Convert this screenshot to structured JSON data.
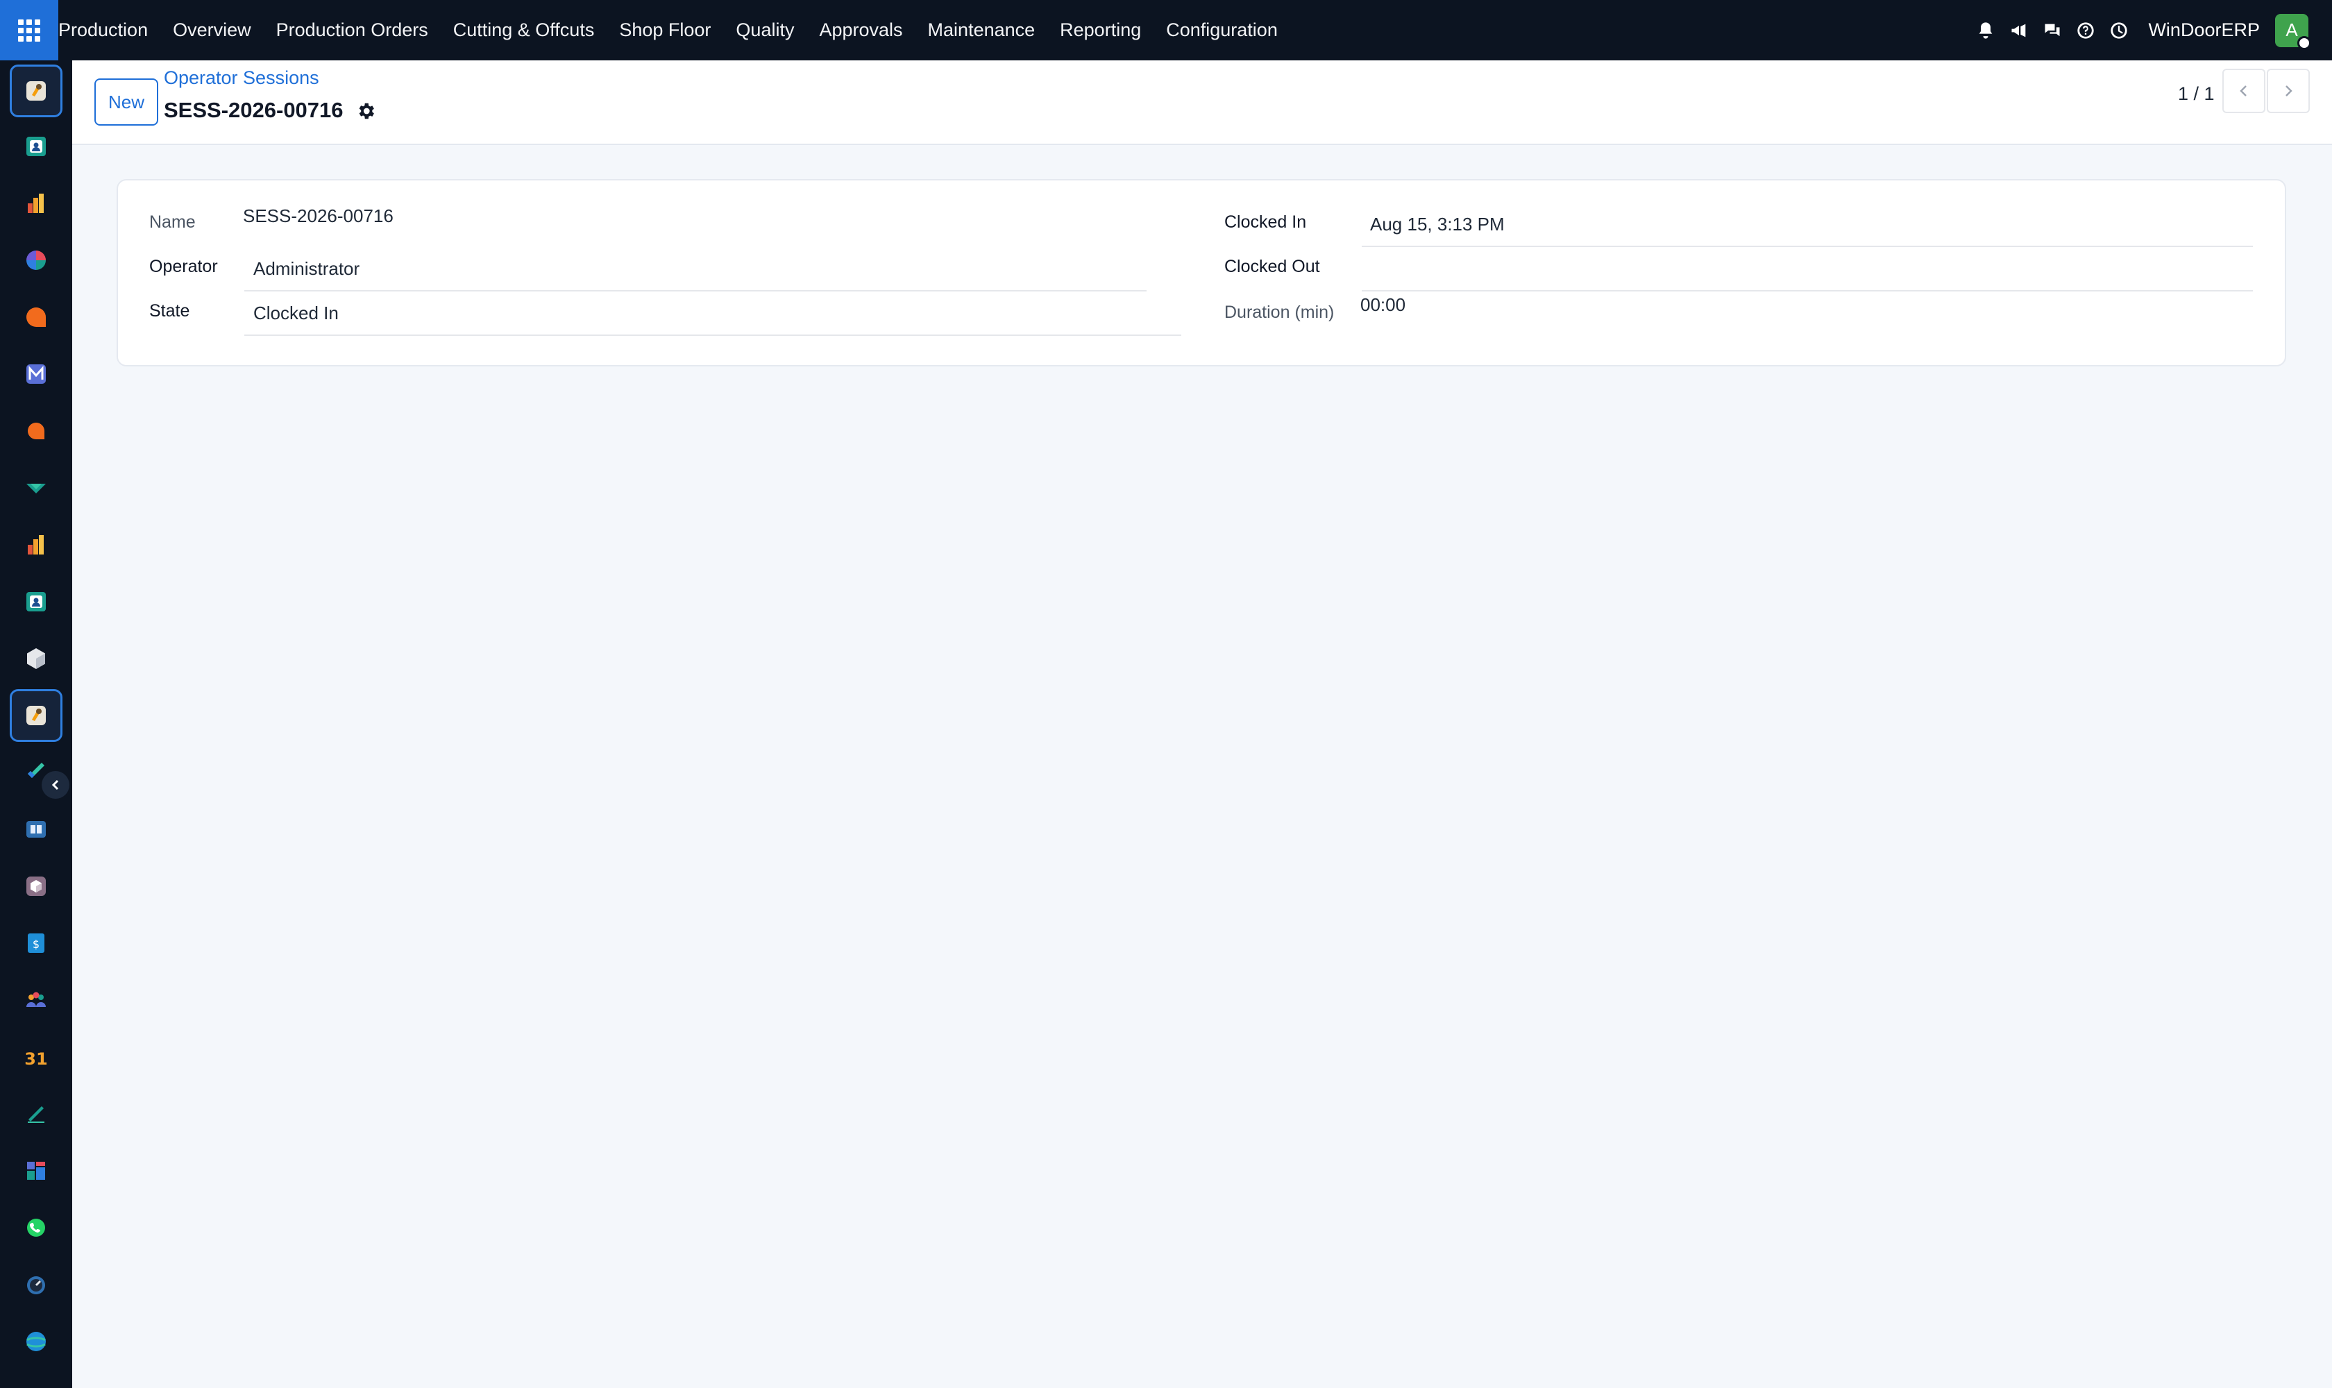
{
  "navbar": {
    "menu": [
      "Production",
      "Overview",
      "Production Orders",
      "Cutting & Offcuts",
      "Shop Floor",
      "Quality",
      "Approvals",
      "Maintenance",
      "Reporting",
      "Configuration"
    ],
    "company": "WinDoorERP",
    "avatar_initial": "A",
    "tray_icons": [
      "bell-icon",
      "megaphone-icon",
      "chat-icon",
      "help-icon",
      "clock-icon"
    ]
  },
  "sidebar": {
    "apps": [
      "production-app",
      "contacts-app",
      "reporting-app",
      "dashboard-app",
      "discuss-app",
      "email-app",
      "livechat-app",
      "project-app",
      "analytics-app",
      "employees-app",
      "inventory-app",
      "production-app-active",
      "todo-app",
      "knowledge-app",
      "product-app",
      "invoicing-app",
      "team-app",
      "calendar-app",
      "sign-app",
      "spreadsheet-app",
      "whatsapp-app",
      "timer-app",
      "website-app"
    ]
  },
  "control_panel": {
    "new_label": "New",
    "breadcrumb": "Operator Sessions",
    "record_title": "SESS-2026-00716",
    "pager": "1 / 1"
  },
  "form": {
    "name_label": "Name",
    "name_value": "SESS-2026-00716",
    "operator_label": "Operator",
    "operator_value": "Administrator",
    "state_label": "State",
    "state_value": "Clocked In",
    "clocked_in_label": "Clocked In",
    "clocked_in_value": "Aug 15, 3:13 PM",
    "clocked_out_label": "Clocked Out",
    "clocked_out_value": "",
    "duration_label": "Duration (min)",
    "duration_value": "00:00"
  },
  "colors": {
    "navbar_bg": "#0c1421",
    "accent": "#1f6fd8",
    "page_bg": "#f4f7fb",
    "avatar": "#3fa34d"
  }
}
